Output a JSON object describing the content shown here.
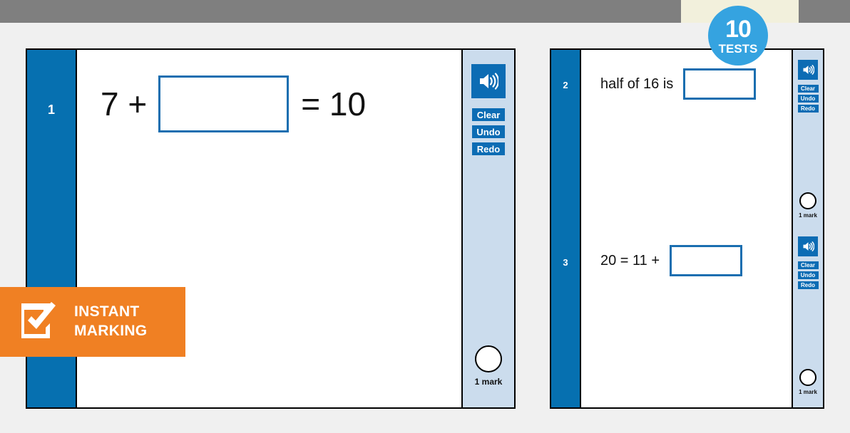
{
  "badge": {
    "count": "10",
    "label": "TESTS",
    "color": "#35a3e0"
  },
  "promo_flag": {
    "line1": "INSTANT",
    "line2": "MARKING",
    "icon": "checkbox-checked-icon",
    "color": "#f08023"
  },
  "colors": {
    "top_bar": "#7f7f7f",
    "top_highlight": "#f2f0dc",
    "page_background": "#f0f0f0",
    "panel_sidebar_blue": "#0670b0",
    "toolbar_light_blue": "#cbdced",
    "button_blue": "#0c6cb4",
    "answer_box_border": "#1a6eb0"
  },
  "toolbar_buttons": {
    "speaker": "speaker-icon",
    "clear": "Clear",
    "undo": "Undo",
    "redo": "Redo"
  },
  "mark_label": "1 mark",
  "panels": [
    {
      "name": "left-test-paper",
      "questions": [
        {
          "number": "1",
          "parts": [
            {
              "type": "text",
              "value": "7 +"
            },
            {
              "type": "answer_box",
              "value": ""
            },
            {
              "type": "text",
              "value": "= 10"
            }
          ],
          "marks": "1 mark"
        }
      ]
    },
    {
      "name": "right-test-paper",
      "questions": [
        {
          "number": "2",
          "parts": [
            {
              "type": "text",
              "value": "half of 16 is"
            },
            {
              "type": "answer_box",
              "value": ""
            }
          ],
          "marks": "1 mark"
        },
        {
          "number": "3",
          "parts": [
            {
              "type": "text",
              "value": "20 = 11 +"
            },
            {
              "type": "answer_box",
              "value": ""
            }
          ],
          "marks": "1 mark"
        }
      ]
    }
  ]
}
